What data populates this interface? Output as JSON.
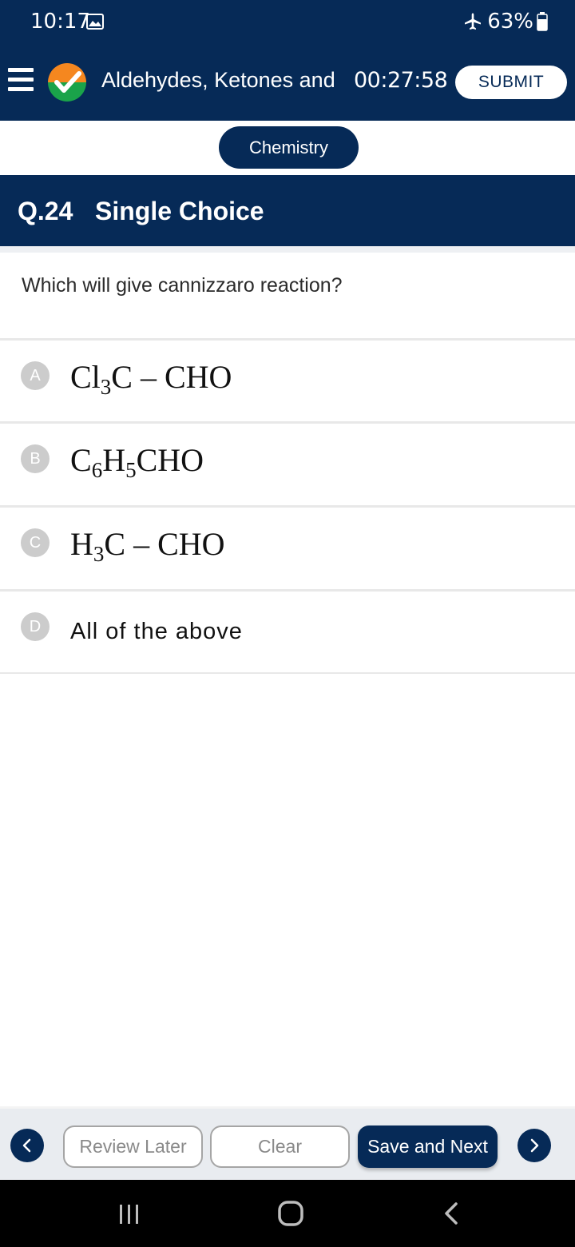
{
  "status_bar": {
    "time": "10:17",
    "battery": "63%",
    "icons": [
      "gallery-icon",
      "airplane-icon",
      "battery-icon"
    ]
  },
  "header": {
    "topic_title": "Aldehydes, Ketones and",
    "timer": "00:27:58",
    "submit_label": "SUBMIT",
    "icons": [
      "menu-icon",
      "logo-check-icon"
    ]
  },
  "subject": "Chemistry",
  "question": {
    "number": "Q.24",
    "type": "Single Choice",
    "text": "Which will give cannizzaro reaction?"
  },
  "options": [
    {
      "letter": "A",
      "formula": {
        "p1": "Cl",
        "s1": "3",
        "p2": "C – CHO"
      }
    },
    {
      "letter": "B",
      "formula": {
        "p1": "C",
        "s1": "6",
        "p2": "H",
        "s2": "5",
        "p3": "CHO"
      }
    },
    {
      "letter": "C",
      "formula": {
        "p1": "H",
        "s1": "3",
        "p2": "C – CHO"
      }
    },
    {
      "letter": "D",
      "text": "All of the above"
    }
  ],
  "actions": {
    "review_label": "Review Later",
    "clear_label": "Clear",
    "save_label": "Save and Next"
  },
  "colors": {
    "primary": "#062a57",
    "logo_orange": "#f5871f",
    "logo_green": "#1aa34a",
    "badge_grey": "#cccccc"
  }
}
